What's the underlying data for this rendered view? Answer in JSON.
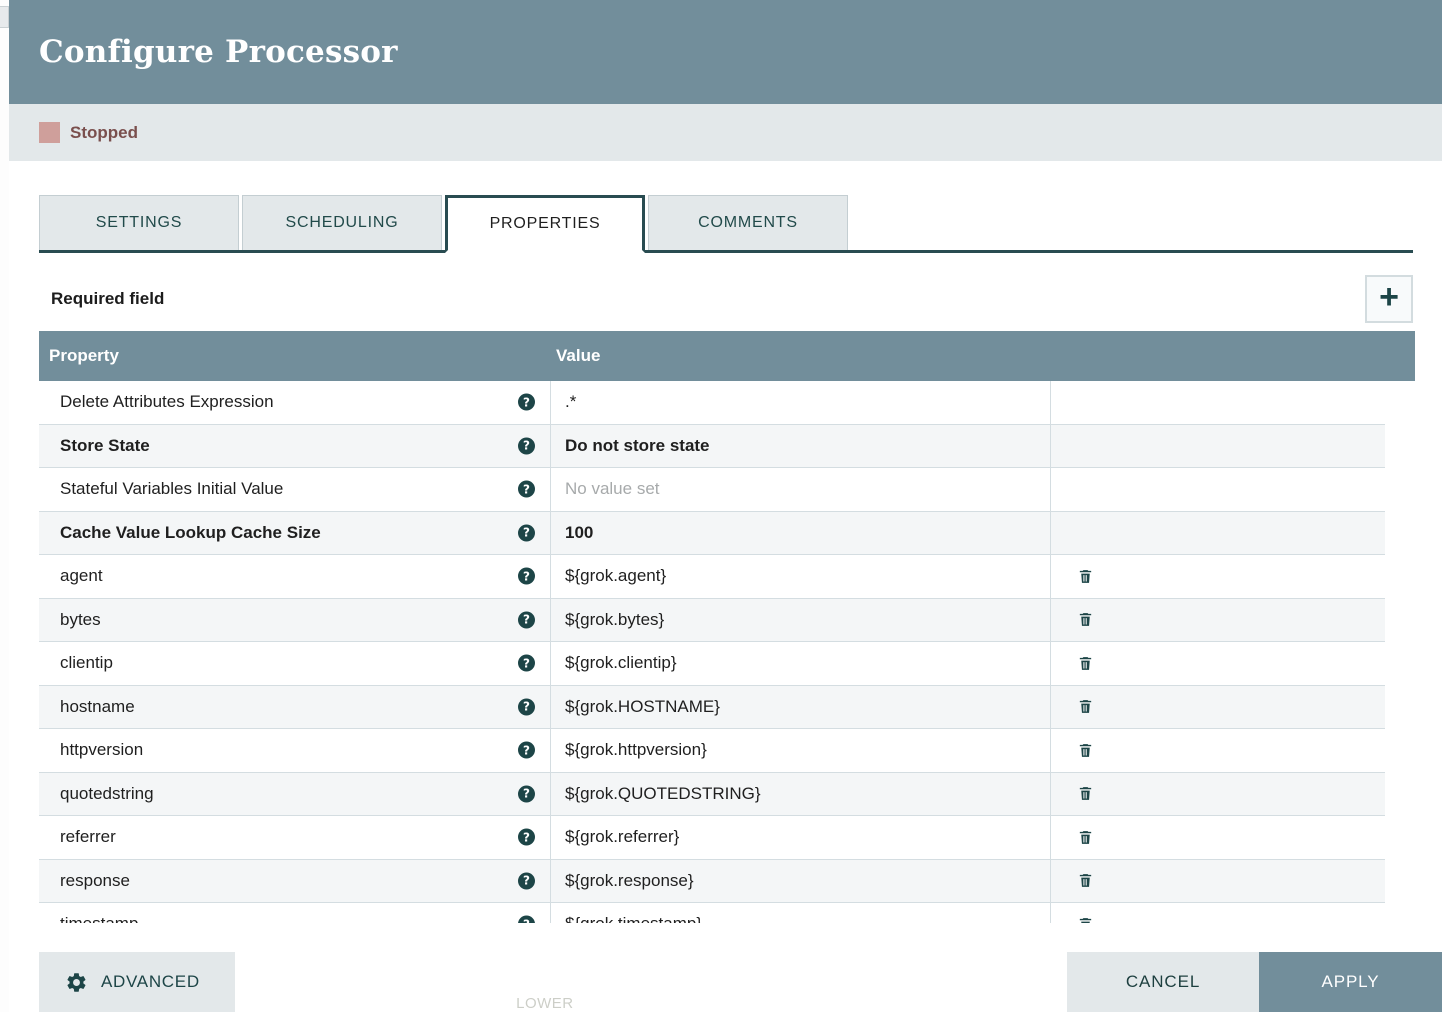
{
  "dialog": {
    "title": "Configure Processor",
    "status": {
      "label": "Stopped",
      "swatch_color": "#cf9f9b",
      "text_color": "#7a4f4d"
    }
  },
  "tabs": [
    {
      "label": "SETTINGS",
      "active": false
    },
    {
      "label": "SCHEDULING",
      "active": false
    },
    {
      "label": "PROPERTIES",
      "active": true
    },
    {
      "label": "COMMENTS",
      "active": false
    }
  ],
  "toolbar": {
    "required_field_label": "Required field",
    "add_property_label": "+"
  },
  "table": {
    "headers": {
      "property": "Property",
      "value": "Value"
    },
    "help_icon_glyph": "?",
    "rows": [
      {
        "property": "Delete Attributes Expression",
        "required": false,
        "value": ".*",
        "value_empty": false,
        "deletable": false
      },
      {
        "property": "Store State",
        "required": true,
        "value": "Do not store state",
        "value_empty": false,
        "deletable": false
      },
      {
        "property": "Stateful Variables Initial Value",
        "required": false,
        "value": "No value set",
        "value_empty": true,
        "deletable": false
      },
      {
        "property": "Cache Value Lookup Cache Size",
        "required": true,
        "value": "100",
        "value_empty": false,
        "deletable": false
      },
      {
        "property": "agent",
        "required": false,
        "value": "${grok.agent}",
        "value_empty": false,
        "deletable": true
      },
      {
        "property": "bytes",
        "required": false,
        "value": "${grok.bytes}",
        "value_empty": false,
        "deletable": true
      },
      {
        "property": "clientip",
        "required": false,
        "value": "${grok.clientip}",
        "value_empty": false,
        "deletable": true
      },
      {
        "property": "hostname",
        "required": false,
        "value": "${grok.HOSTNAME}",
        "value_empty": false,
        "deletable": true
      },
      {
        "property": "httpversion",
        "required": false,
        "value": "${grok.httpversion}",
        "value_empty": false,
        "deletable": true
      },
      {
        "property": "quotedstring",
        "required": false,
        "value": "${grok.QUOTEDSTRING}",
        "value_empty": false,
        "deletable": true
      },
      {
        "property": "referrer",
        "required": false,
        "value": "${grok.referrer}",
        "value_empty": false,
        "deletable": true
      },
      {
        "property": "response",
        "required": false,
        "value": "${grok.response}",
        "value_empty": false,
        "deletable": true
      },
      {
        "property": "timestamp",
        "required": false,
        "value": "${grok.timestamp}",
        "value_empty": false,
        "deletable": true
      }
    ]
  },
  "footer": {
    "advanced_label": "ADVANCED",
    "cancel_label": "CANCEL",
    "apply_label": "APPLY"
  },
  "colors": {
    "header_bg": "#728e9b",
    "status_bg": "#e3e8ea",
    "accent_dark": "#1d4547",
    "tab_active_border": "#294c51",
    "row_alt": "#f4f6f7",
    "row_border": "#d4dde1"
  }
}
